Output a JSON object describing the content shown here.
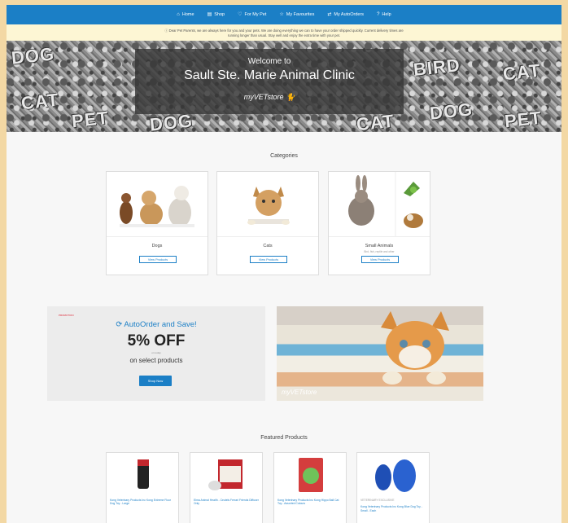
{
  "nav": [
    {
      "icon": "⌂",
      "label": "Home"
    },
    {
      "icon": "▤",
      "label": "Shop"
    },
    {
      "icon": "♡",
      "label": "For My Pet"
    },
    {
      "icon": "☆",
      "label": "My Favourites"
    },
    {
      "icon": "⇄",
      "label": "My AutoOrders"
    },
    {
      "icon": "?",
      "label": "Help"
    }
  ],
  "notice": {
    "line1": "ⓘ Dear Pet Parents, we are always here for you and your pets. We are doing everything we can to have your order shipped quickly. Current delivery times are",
    "line2": "running longer than usual. Stay well and enjoy the extra time with your pet."
  },
  "hero": {
    "welcome": "Welcome to",
    "title": "Sault Ste. Marie Animal Clinic",
    "logo": "myVETstore",
    "pattern_words": [
      "DOG",
      "CAT",
      "PET",
      "BIRD",
      "DOG",
      "CAT",
      "PET",
      "DOG",
      "CAT"
    ]
  },
  "categories": {
    "title": "Categories",
    "items": [
      {
        "name": "Dogs",
        "sub": "",
        "button": "View Products"
      },
      {
        "name": "Cats",
        "sub": "",
        "button": "View Products"
      },
      {
        "name": "Small Animals",
        "sub": "Bird, fish, reptile and other",
        "button": "View Products"
      }
    ]
  },
  "promo": {
    "tag": "PROMOTION",
    "headline": "AutoOrder and Save!",
    "discount": "5% OFF",
    "note": "on today",
    "subline": "on select products",
    "button": "Shop Now"
  },
  "banner": {
    "logo": "myVETstore"
  },
  "featured": {
    "title": "Featured Products",
    "items": [
      {
        "name": "Kong Veterinary Products Inc Kong Extreme Floor Dog Toy - Large"
      },
      {
        "name": "Elma Animal Health - Ceutels Ferrari Friends Diffuser Only"
      },
      {
        "name": "Kong Veterinary Products Inc Kong Hippo Ball Cat Toy - Assorted Colours"
      },
      {
        "name": "Kong Veterinary Products Inc Kong Blue Dog Toy - Small - Each"
      }
    ],
    "badge": "VETERINARY EXCLUSIVE"
  }
}
